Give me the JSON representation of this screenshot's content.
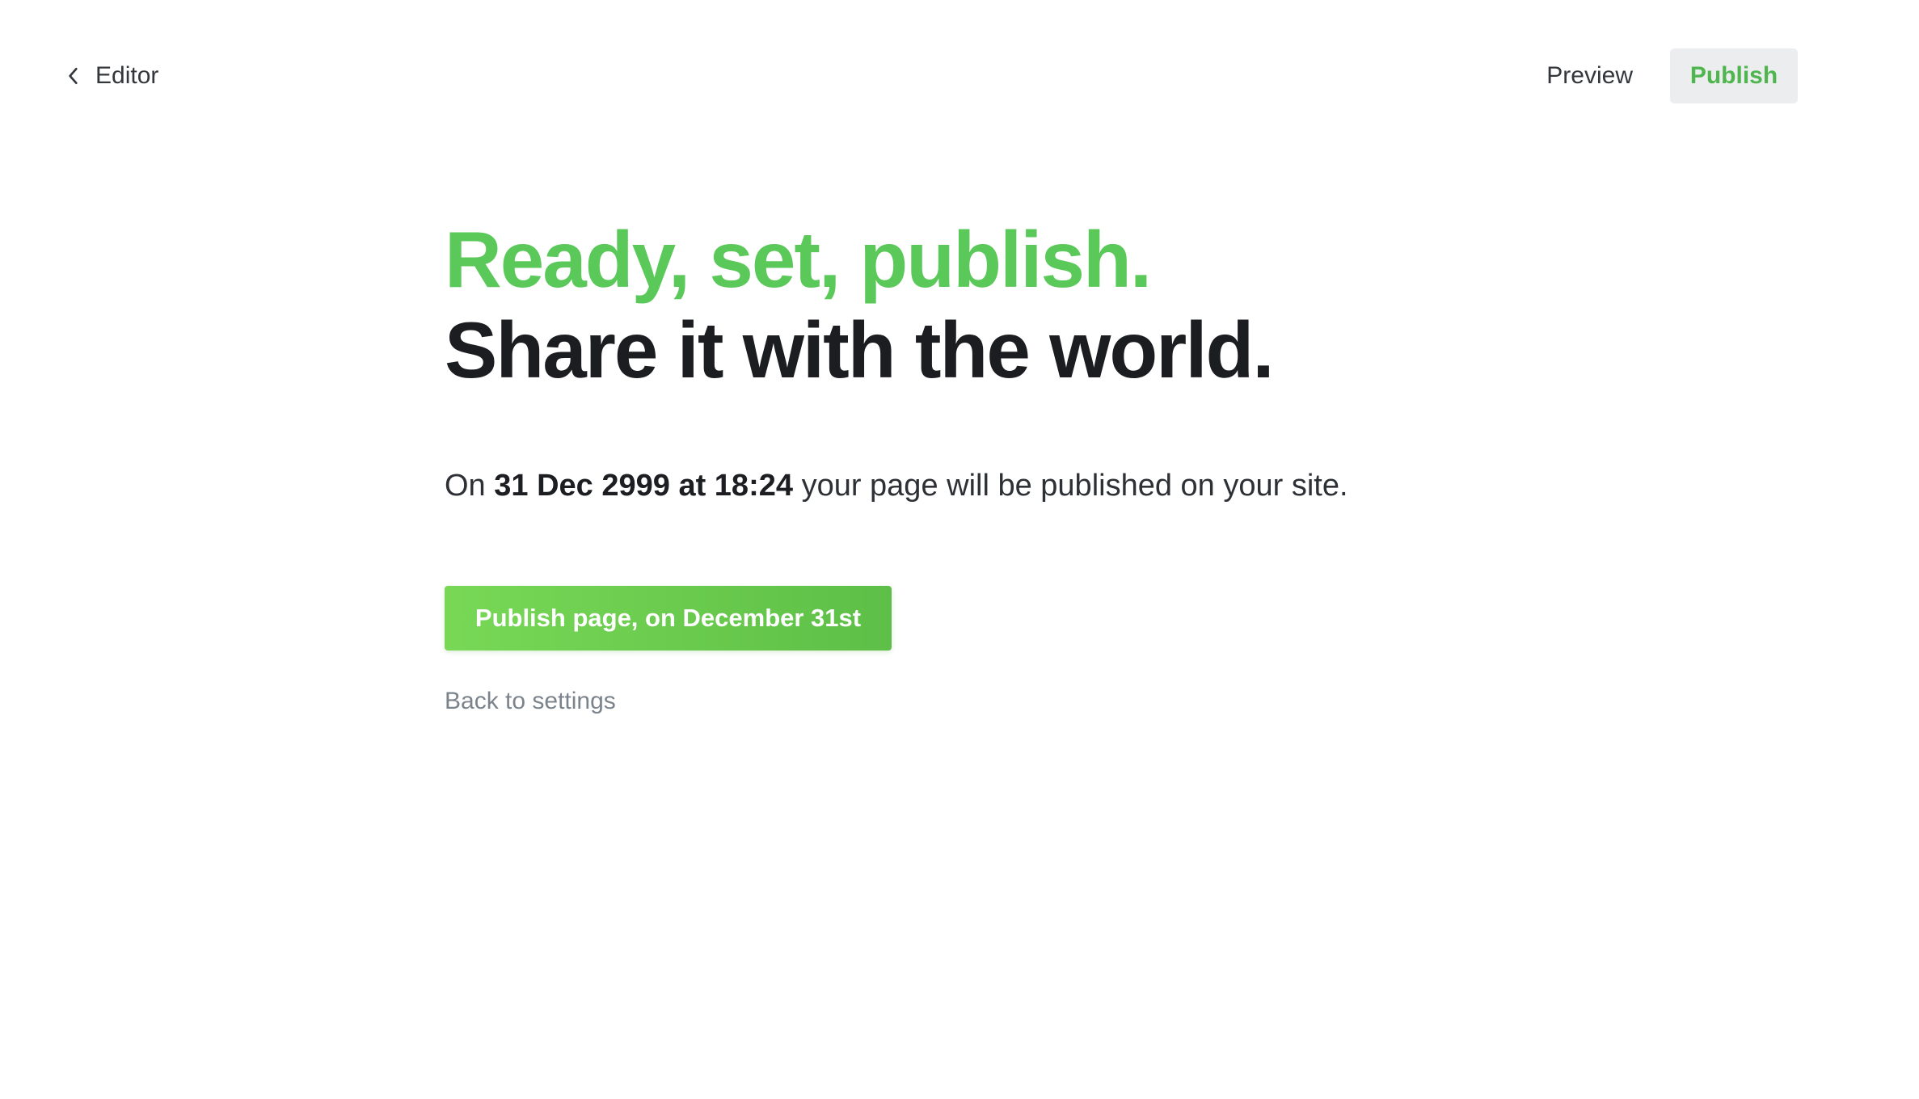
{
  "topbar": {
    "back": {
      "icon": "chevron-left-icon",
      "label": "Editor"
    },
    "preview_label": "Preview",
    "publish_label": "Publish"
  },
  "hero": {
    "line1": "Ready, set, publish.",
    "line2": "Share it with the world."
  },
  "schedule": {
    "prefix": "On",
    "datetime": "31 Dec 2999 at 18:24",
    "suffix": "your page will be published on your site."
  },
  "cta": {
    "label": "Publish page, on December 31st"
  },
  "secondary": {
    "label": "Back to settings"
  },
  "colors": {
    "accent": "#5bc95a",
    "cta_gradient_start": "#78d856",
    "cta_gradient_end": "#5dbf47",
    "text_dark": "#1b1d20",
    "muted_link": "#7b848c",
    "publish_button_bg": "#ecedef"
  }
}
